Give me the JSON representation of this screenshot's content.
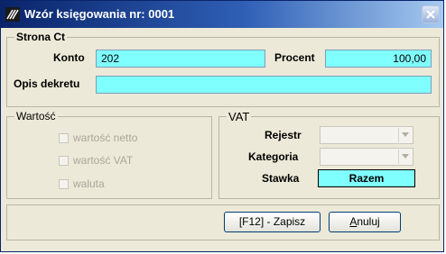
{
  "window": {
    "title": "Wzór księgowania nr: 0001"
  },
  "strona": {
    "group_title": "Strona Ct",
    "konto_label": "Konto",
    "konto_value": "202",
    "procent_label": "Procent",
    "procent_value": "100,00",
    "opis_label": "Opis dekretu",
    "opis_value": ""
  },
  "wartosc": {
    "group_title": "Wartość",
    "options": [
      {
        "label": "wartość netto",
        "checked": false
      },
      {
        "label": "wartość VAT",
        "checked": false
      },
      {
        "label": "waluta",
        "checked": false
      }
    ]
  },
  "vat": {
    "group_title": "VAT",
    "rejestr_label": "Rejestr",
    "rejestr_value": "",
    "kategoria_label": "Kategoria",
    "kategoria_value": "",
    "stawka_label": "Stawka",
    "stawka_value": "Razem"
  },
  "buttons": {
    "save_label": "[F12] - Zapisz",
    "cancel_accel": "A",
    "cancel_rest": "nuluj"
  },
  "colors": {
    "field_bg": "#80ffff",
    "title_bar": "#0a246a"
  }
}
